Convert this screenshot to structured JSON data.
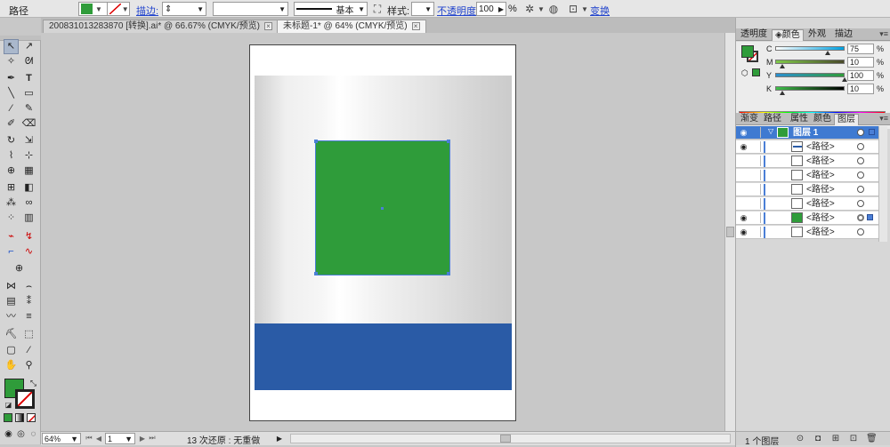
{
  "control_bar": {
    "selection_type": "路径",
    "fill_color": "#2f9c3a",
    "stroke_label": "描边:",
    "stroke_weight": "",
    "brush_label": "基本",
    "style_label": "样式:",
    "opacity_label": "不透明度:",
    "opacity_value": "100",
    "opacity_unit": "%",
    "transform_label": "变换"
  },
  "tabs": [
    {
      "label": "200831013283870 [转换].ai* @ 66.67% (CMYK/预览)",
      "close": "×"
    },
    {
      "label": "未标题-1* @ 64% (CMYK/预览)",
      "close": "×"
    }
  ],
  "status_bar": {
    "zoom": "64%",
    "artboard_number": "1",
    "undo_text": "13 次还原 : 无重做"
  },
  "color_panel": {
    "tabs": [
      "透明度",
      "颜色",
      "外观",
      "描边"
    ],
    "active_tab": "颜色",
    "fill_color": "#2f9c3a",
    "sliders": [
      {
        "label": "C",
        "value": "75",
        "unit": "%",
        "level": 75
      },
      {
        "label": "M",
        "value": "10",
        "unit": "%",
        "level": 10
      },
      {
        "label": "Y",
        "value": "100",
        "unit": "%",
        "level": 100
      },
      {
        "label": "K",
        "value": "10",
        "unit": "%",
        "level": 10
      }
    ]
  },
  "layers_panel": {
    "tabs": [
      "渐变",
      "路径",
      "属性",
      "颜色",
      "图层"
    ],
    "active_tab": "图层",
    "top_layer": {
      "name": "图层 1"
    },
    "items": [
      {
        "name": "<路径>",
        "visible": false,
        "thumb": "line"
      },
      {
        "name": "<路径>",
        "visible": false,
        "thumb": "white"
      },
      {
        "name": "<路径>",
        "visible": false,
        "thumb": "white"
      },
      {
        "name": "<路径>",
        "visible": false,
        "thumb": "white"
      },
      {
        "name": "<路径>",
        "visible": true,
        "thumb": "green",
        "selected": true
      },
      {
        "name": "<路径>",
        "visible": true,
        "thumb": "white"
      }
    ],
    "footer_count": "1 个图层"
  },
  "colors": {
    "green": "#2f9c3a",
    "blue": "#2a5ba6",
    "selection": "#4b7fd6"
  }
}
